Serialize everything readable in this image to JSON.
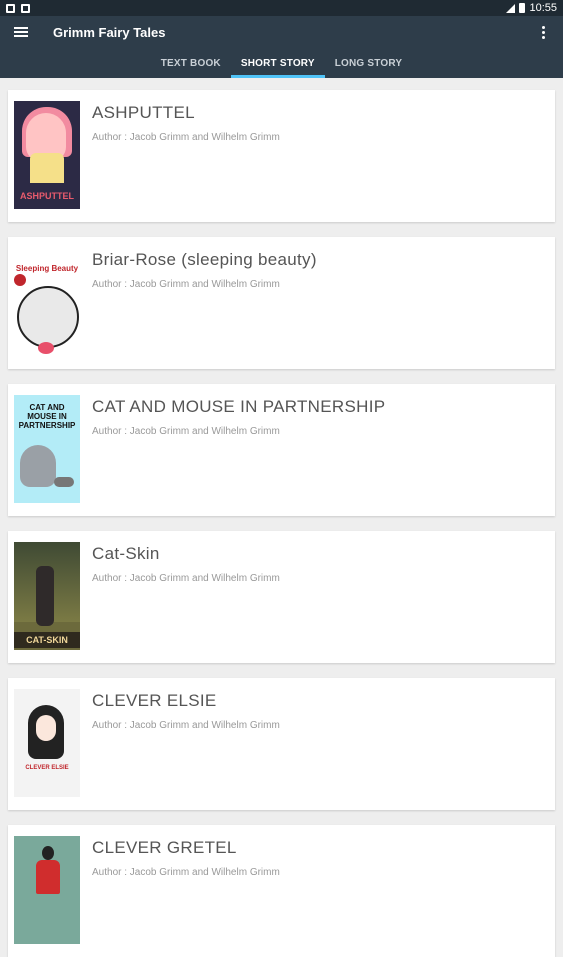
{
  "status_bar": {
    "time": "10:55"
  },
  "app_bar": {
    "title": "Grimm Fairy Tales"
  },
  "tabs": [
    {
      "label": "TEXT BOOK",
      "active": false
    },
    {
      "label": "SHORT STORY",
      "active": true
    },
    {
      "label": "LONG STORY",
      "active": false
    }
  ],
  "stories": [
    {
      "title": "ASHPUTTEL",
      "author": "Author : Jacob Grimm and Wilhelm Grimm",
      "cover_text": "ASHPUTTEL"
    },
    {
      "title": "Briar-Rose (sleeping beauty)",
      "author": "Author : Jacob Grimm and Wilhelm Grimm",
      "cover_text": "Sleeping Beauty"
    },
    {
      "title": "CAT AND MOUSE IN PARTNERSHIP",
      "author": "Author : Jacob Grimm and Wilhelm Grimm",
      "cover_text": "CAT AND MOUSE IN PARTNERSHIP"
    },
    {
      "title": "Cat-Skin",
      "author": "Author : Jacob Grimm and Wilhelm Grimm",
      "cover_text": "CAT-SKIN"
    },
    {
      "title": "CLEVER ELSIE",
      "author": "Author : Jacob Grimm and Wilhelm Grimm",
      "cover_text": "CLEVER ELSIE"
    },
    {
      "title": "CLEVER GRETEL",
      "author": "Author : Jacob Grimm and Wilhelm Grimm"
    }
  ],
  "colors": {
    "status_bar": "#1f2a33",
    "app_bar": "#2e3d4a",
    "tab_indicator": "#4fc3f7",
    "background": "#eeeeee"
  }
}
